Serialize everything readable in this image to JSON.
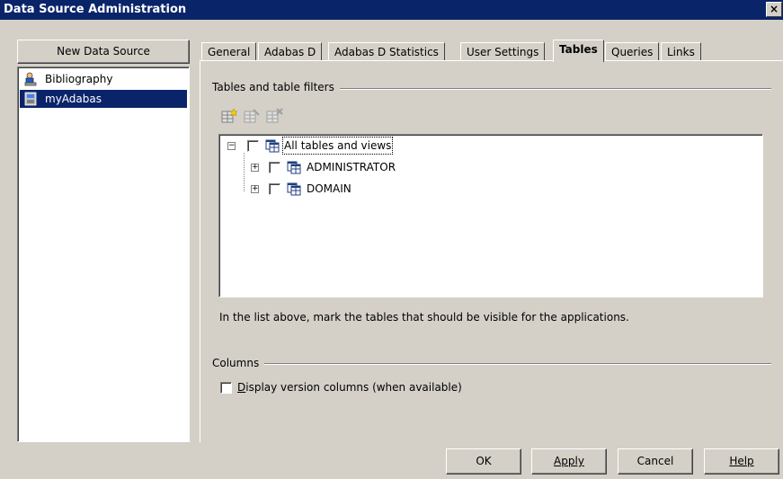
{
  "window": {
    "title": "Data Source Administration",
    "close_glyph": "×"
  },
  "sidebar": {
    "new_button": "New Data Source",
    "items": [
      {
        "label": "Bibliography",
        "icon": "database-person-icon",
        "selected": false
      },
      {
        "label": "myAdabas",
        "icon": "database-icon",
        "selected": true
      }
    ]
  },
  "tabs": [
    {
      "label": "General",
      "active": false
    },
    {
      "label": "Adabas D",
      "active": false
    },
    {
      "label": "Adabas D Statistics",
      "active": false
    },
    {
      "label": "User Settings",
      "active": false
    },
    {
      "label": "Tables",
      "active": true
    },
    {
      "label": "Queries",
      "active": false
    },
    {
      "label": "Links",
      "active": false
    }
  ],
  "tables_group": {
    "label": "Tables and table filters",
    "toolbar": [
      "new-table-icon",
      "edit-table-icon",
      "delete-table-icon"
    ],
    "tree": {
      "root": {
        "label": "All tables and views",
        "expanded": true,
        "checked": false
      },
      "children": [
        {
          "label": "ADMINISTRATOR",
          "expanded": false,
          "checked": false
        },
        {
          "label": "DOMAIN",
          "expanded": false,
          "checked": false
        }
      ]
    },
    "hint": "In the list above, mark the tables that should be visible for the applications."
  },
  "columns_group": {
    "label": "Columns",
    "version_checkbox": {
      "label_mnemonic": "D",
      "label_rest": "isplay version columns (when available)",
      "checked": false
    }
  },
  "buttons": {
    "ok": "OK",
    "apply": "Apply",
    "cancel": "Cancel",
    "help": "Help"
  },
  "colors": {
    "title_bar": "#0a246a",
    "face": "#d4d0c8",
    "selection": "#0a246a"
  }
}
